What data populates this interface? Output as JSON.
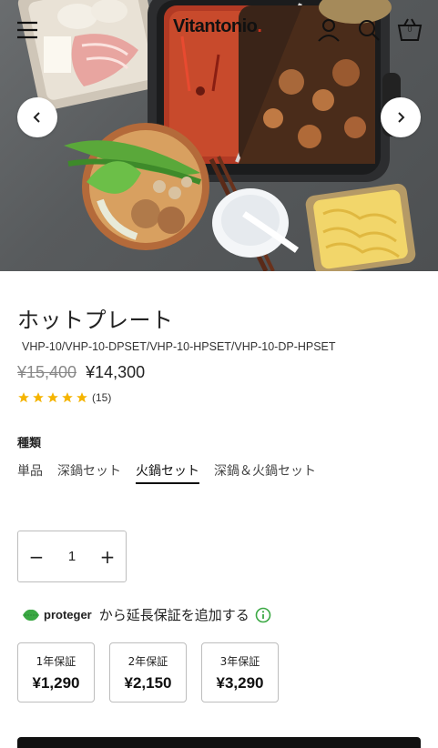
{
  "header": {
    "brand_name": "Vitantonio",
    "cart_count": "0",
    "icons": [
      "menu-icon",
      "account-icon",
      "search-icon",
      "cart-icon"
    ]
  },
  "gallery": {
    "prev_icon": "chevron-left-icon",
    "next_icon": "chevron-right-icon"
  },
  "product": {
    "title": "ホットプレート",
    "sku": "VHP-10/VHP-10-DPSET/VHP-10-HPSET/VHP-10-DP-HPSET",
    "compare_price": "¥15,400",
    "price": "¥14,300",
    "rating": 5,
    "review_count": "(15)",
    "star_color": "#f5b400"
  },
  "variant": {
    "label": "種類",
    "options": [
      "単品",
      "深鍋セット",
      "火鍋セット",
      "深鍋＆火鍋セット"
    ],
    "selected": "火鍋セット"
  },
  "quantity": {
    "value": "1",
    "minus": "−",
    "plus": "+"
  },
  "warranty": {
    "provider": "proteger",
    "text": "から延長保証を追加する",
    "plans": [
      {
        "term": "1年保証",
        "price": "¥1,290"
      },
      {
        "term": "2年保証",
        "price": "¥2,150"
      },
      {
        "term": "3年保証",
        "price": "¥3,290"
      }
    ],
    "accent_color": "#3aa843"
  },
  "colors": {
    "text": "#222222",
    "button_bg": "#111111"
  }
}
